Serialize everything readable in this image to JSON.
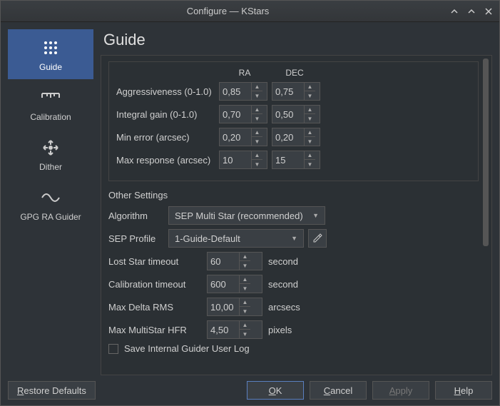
{
  "window": {
    "title": "Configure — KStars"
  },
  "sidebar": {
    "items": [
      {
        "label": "Guide"
      },
      {
        "label": "Calibration"
      },
      {
        "label": "Dither"
      },
      {
        "label": "GPG RA Guider"
      }
    ]
  },
  "main": {
    "title": "Guide",
    "columns": {
      "ra": "RA",
      "dec": "DEC"
    },
    "rows": {
      "aggr": {
        "label": "Aggressiveness (0-1.0)",
        "ra": "0,85",
        "dec": "0,75"
      },
      "igain": {
        "label": "Integral gain (0-1.0)",
        "ra": "0,70",
        "dec": "0,50"
      },
      "minerr": {
        "label": "Min error (arcsec)",
        "ra": "0,20",
        "dec": "0,20"
      },
      "maxresp": {
        "label": "Max response (arcsec)",
        "ra": "10",
        "dec": "15"
      }
    },
    "other": {
      "heading": "Other Settings",
      "algorithm": {
        "label": "Algorithm",
        "value": "SEP Multi Star (recommended)"
      },
      "sepprofile": {
        "label": "SEP Profile",
        "value": "1-Guide-Default"
      },
      "lost": {
        "label": "Lost Star timeout",
        "value": "60",
        "unit": "second"
      },
      "calib": {
        "label": "Calibration timeout",
        "value": "600",
        "unit": "second"
      },
      "rms": {
        "label": "Max Delta RMS",
        "value": "10,00",
        "unit": "arcsecs"
      },
      "hfr": {
        "label": "Max MultiStar HFR",
        "value": "4,50",
        "unit": "pixels"
      },
      "savelog": {
        "prefix": "S",
        "rest": "ave Internal Guider User Log"
      }
    }
  },
  "footer": {
    "restore": {
      "prefix": "R",
      "rest": "estore Defaults"
    },
    "ok": {
      "prefix": "O",
      "rest": "K"
    },
    "cancel": {
      "prefix": "C",
      "rest": "ancel"
    },
    "apply": {
      "prefix": "A",
      "rest": "pply"
    },
    "help": {
      "prefix": "H",
      "rest": "elp"
    }
  }
}
